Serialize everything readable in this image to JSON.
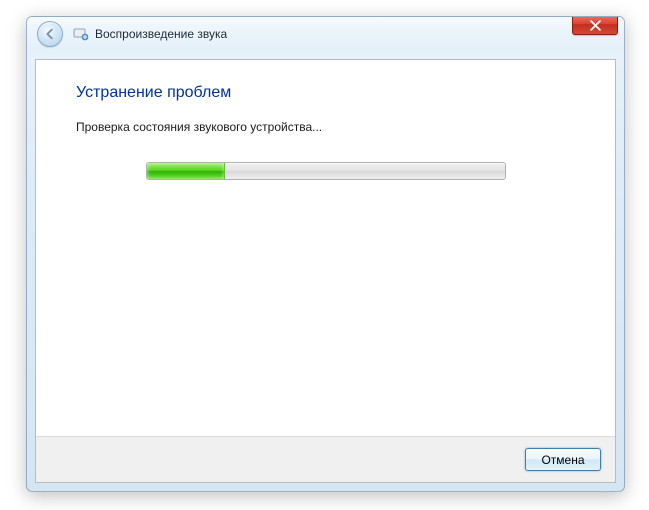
{
  "window": {
    "title": "Воспроизведение звука"
  },
  "content": {
    "heading": "Устранение проблем",
    "status": "Проверка состояния звукового устройства...",
    "progress_percent": 22
  },
  "footer": {
    "cancel_label": "Отмена"
  },
  "colors": {
    "heading": "#003399",
    "progress_green": "#2db200"
  }
}
